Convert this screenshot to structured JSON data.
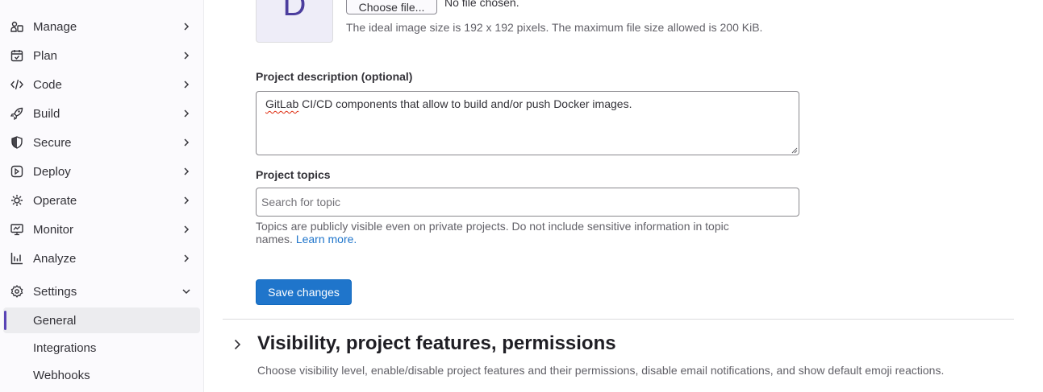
{
  "sidebar": {
    "items": [
      {
        "label": "Manage",
        "icon": "manage-icon"
      },
      {
        "label": "Plan",
        "icon": "plan-icon"
      },
      {
        "label": "Code",
        "icon": "code-icon"
      },
      {
        "label": "Build",
        "icon": "build-icon"
      },
      {
        "label": "Secure",
        "icon": "shield-icon"
      },
      {
        "label": "Deploy",
        "icon": "deploy-icon"
      },
      {
        "label": "Operate",
        "icon": "operate-icon"
      },
      {
        "label": "Monitor",
        "icon": "monitor-icon"
      },
      {
        "label": "Analyze",
        "icon": "analyze-icon"
      },
      {
        "label": "Settings",
        "icon": "gear-icon"
      }
    ],
    "subitems": [
      {
        "label": "General",
        "active": true
      },
      {
        "label": "Integrations"
      },
      {
        "label": "Webhooks"
      }
    ]
  },
  "avatar": {
    "letter": "D"
  },
  "file": {
    "button_label": "Choose file...",
    "status": "No file chosen.",
    "help": "The ideal image size is 192 x 192 pixels. The maximum file size allowed is 200 KiB."
  },
  "description": {
    "label": "Project description (optional)",
    "value_first_word": "GitLab",
    "value_rest": " CI/CD components that allow to build and/or push Docker images."
  },
  "topics": {
    "label": "Project topics",
    "placeholder": "Search for topic",
    "help_line1": "Topics are publicly visible even on private projects. Do not include sensitive information in topic",
    "help_line2": "names. ",
    "help_link": "Learn more."
  },
  "save_label": "Save changes",
  "visibility_section": {
    "title": "Visibility, project features, permissions",
    "description": "Choose visibility level, enable/disable project features and their permissions, disable email notifications, and show default emoji reactions."
  },
  "colors": {
    "accent": "#1f75cb",
    "active_indicator": "#5943b6",
    "avatar_bg": "#eeedf8"
  }
}
